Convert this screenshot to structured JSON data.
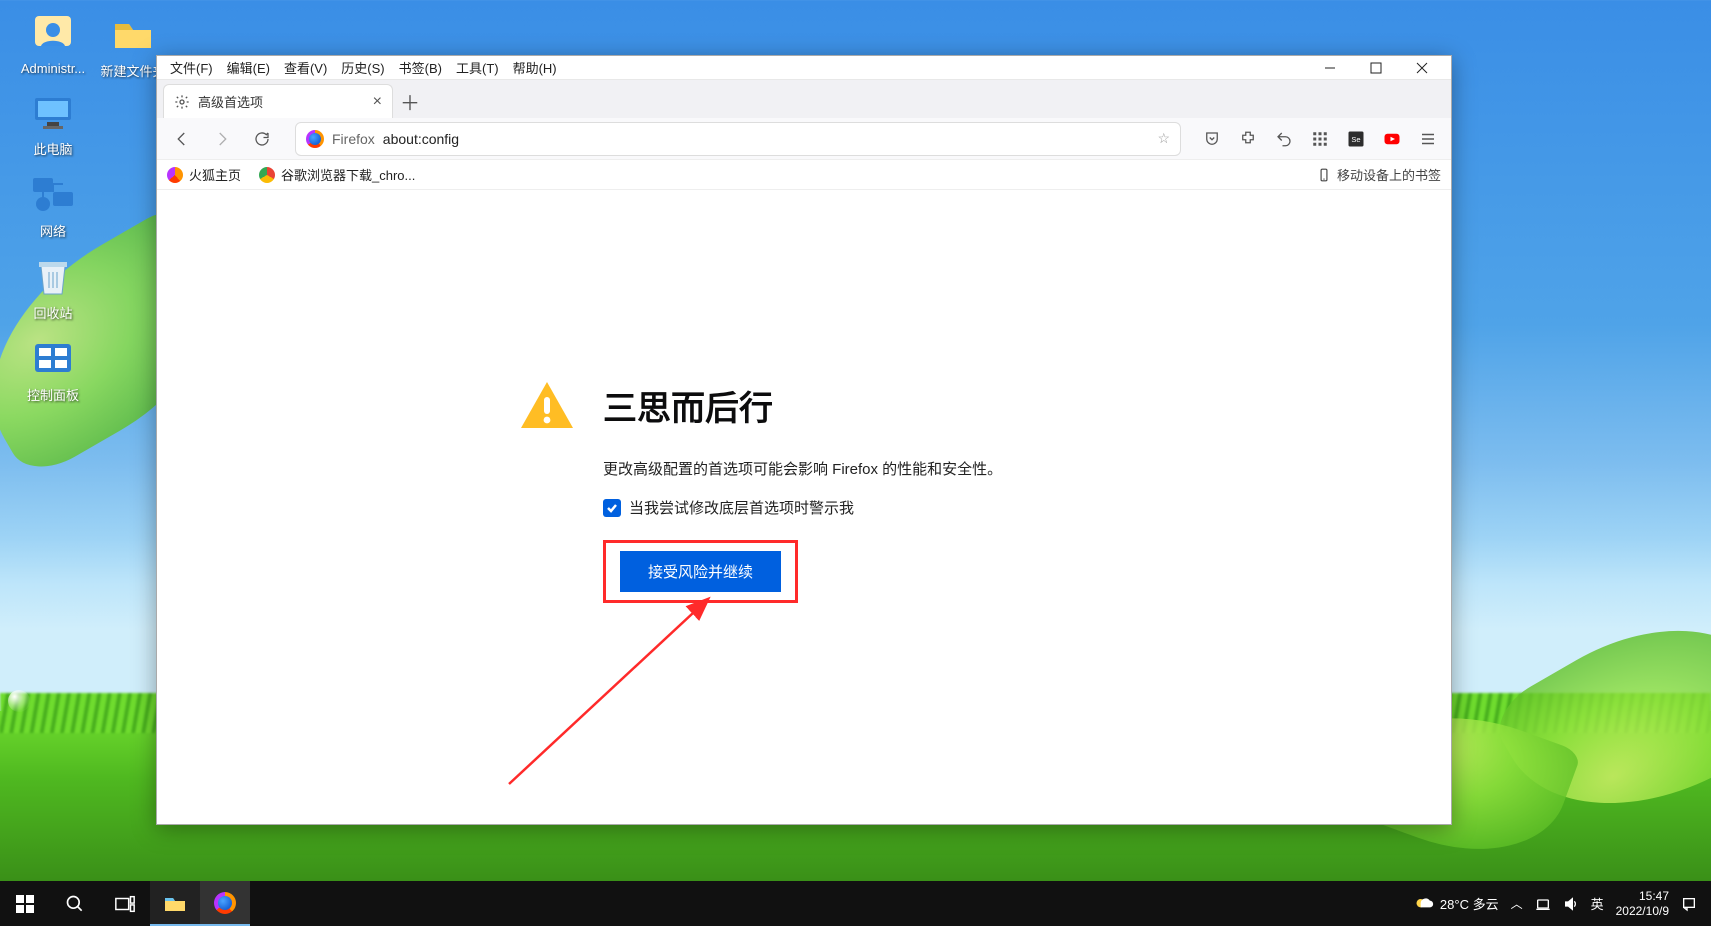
{
  "desktop": {
    "admin": "Administr...",
    "newfolder": "新建文件夹",
    "thispc": "此电脑",
    "network": "网络",
    "recycle": "回收站",
    "ctrlpanel": "控制面板"
  },
  "window": {
    "menus": {
      "file": "文件(F)",
      "edit": "编辑(E)",
      "view": "查看(V)",
      "history": "历史(S)",
      "bookmarks": "书签(B)",
      "tools": "工具(T)",
      "help": "帮助(H)"
    }
  },
  "tab": {
    "title": "高级首选项"
  },
  "url": {
    "prefix": "Firefox",
    "value": "about:config"
  },
  "bookmarks": {
    "b1": "火狐主页",
    "b2": "谷歌浏览器下载_chro...",
    "right": "移动设备上的书签"
  },
  "page": {
    "title": "三思而后行",
    "text": "更改高级配置的首选项可能会影响 Firefox 的性能和安全性。",
    "checkbox": "当我尝试修改底层首选项时警示我",
    "button": "接受风险并继续"
  },
  "tray": {
    "weather": "28°C 多云",
    "ime": "英",
    "time": "15:47",
    "date": "2022/10/9"
  }
}
